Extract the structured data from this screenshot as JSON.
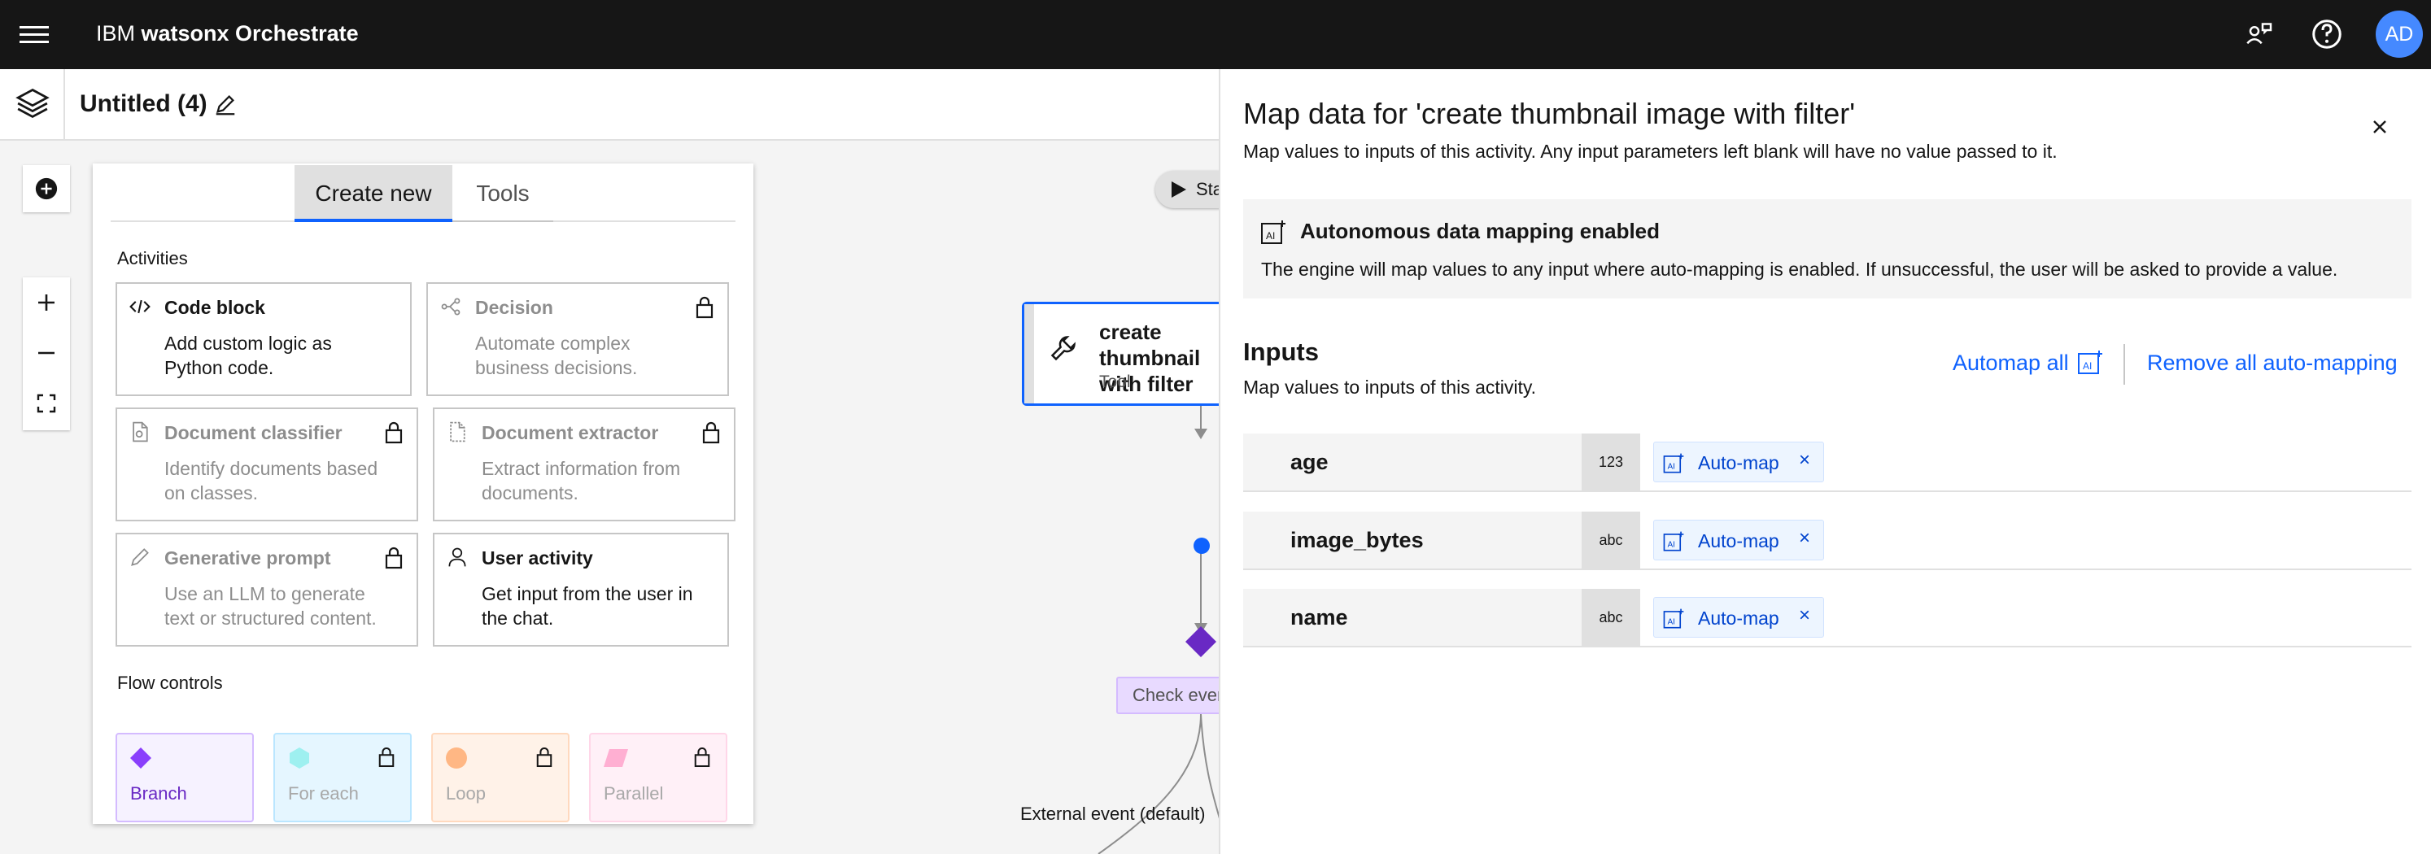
{
  "app": {
    "brand_prefix": "IBM",
    "brand_name": "watsonx Orchestrate",
    "avatar_initials": "AD"
  },
  "flow": {
    "title": "Untitled (4)"
  },
  "palette": {
    "tabs": [
      {
        "label": "Create new",
        "active": true
      },
      {
        "label": "Tools",
        "active": false
      }
    ],
    "activities_label": "Activities",
    "activities": [
      {
        "title": "Code block",
        "desc": "Add custom logic as Python code.",
        "icon": "code-icon",
        "locked": false
      },
      {
        "title": "Decision",
        "desc": "Automate complex business decisions.",
        "icon": "decision-icon",
        "locked": true
      },
      {
        "title": "Document classifier",
        "desc": "Identify documents based on classes.",
        "icon": "document-icon",
        "locked": true
      },
      {
        "title": "Document extractor",
        "desc": "Extract information from documents.",
        "icon": "document-extract-icon",
        "locked": true
      },
      {
        "title": "Generative prompt",
        "desc": "Use an LLM to generate text or structured content.",
        "icon": "pen-icon",
        "locked": true
      },
      {
        "title": "User activity",
        "desc": "Get input from the user in the chat.",
        "icon": "user-icon",
        "locked": false
      }
    ],
    "flow_controls_label": "Flow controls",
    "flow_controls": [
      {
        "label": "Branch",
        "locked": false,
        "color": "#8a3ffc",
        "bg": "#f6f2ff"
      },
      {
        "label": "For each",
        "locked": true,
        "color": "#9ef0f0",
        "bg": "#e5f6ff"
      },
      {
        "label": "Loop",
        "locked": true,
        "color": "#ffb784",
        "bg": "#fff2e8"
      },
      {
        "label": "Parallel",
        "locked": true,
        "color": "#ffafd2",
        "bg": "#fff0f7"
      }
    ]
  },
  "graph": {
    "start_label": "Start",
    "node_title": "create thumbnail\nwith filter",
    "node_subtitle": "Tool",
    "check_label": "Check event",
    "external_event_label": "External event (default)"
  },
  "panel": {
    "title": "Map data for 'create thumbnail image with filter'",
    "subtitle": "Map values to inputs of this activity. Any input parameters left blank will have no value passed to it.",
    "notice_title": "Autonomous data mapping enabled",
    "notice_desc": "The engine will map values to any input where auto-mapping is enabled. If unsuccessful, the user will be asked to provide a value.",
    "inputs_heading": "Inputs",
    "inputs_sub": "Map values to inputs of this activity.",
    "automap_all": "Automap all",
    "remove_all": "Remove all auto-mapping",
    "inputs": [
      {
        "name": "age",
        "type": "123",
        "tag": "Auto-map"
      },
      {
        "name": "image_bytes",
        "type": "abc",
        "tag": "Auto-map"
      },
      {
        "name": "name",
        "type": "abc",
        "tag": "Auto-map"
      }
    ]
  },
  "colors": {
    "accent": "#0f62fe",
    "topbar": "#161616",
    "avatar": "#4589ff",
    "branch": "#8a3ffc"
  }
}
